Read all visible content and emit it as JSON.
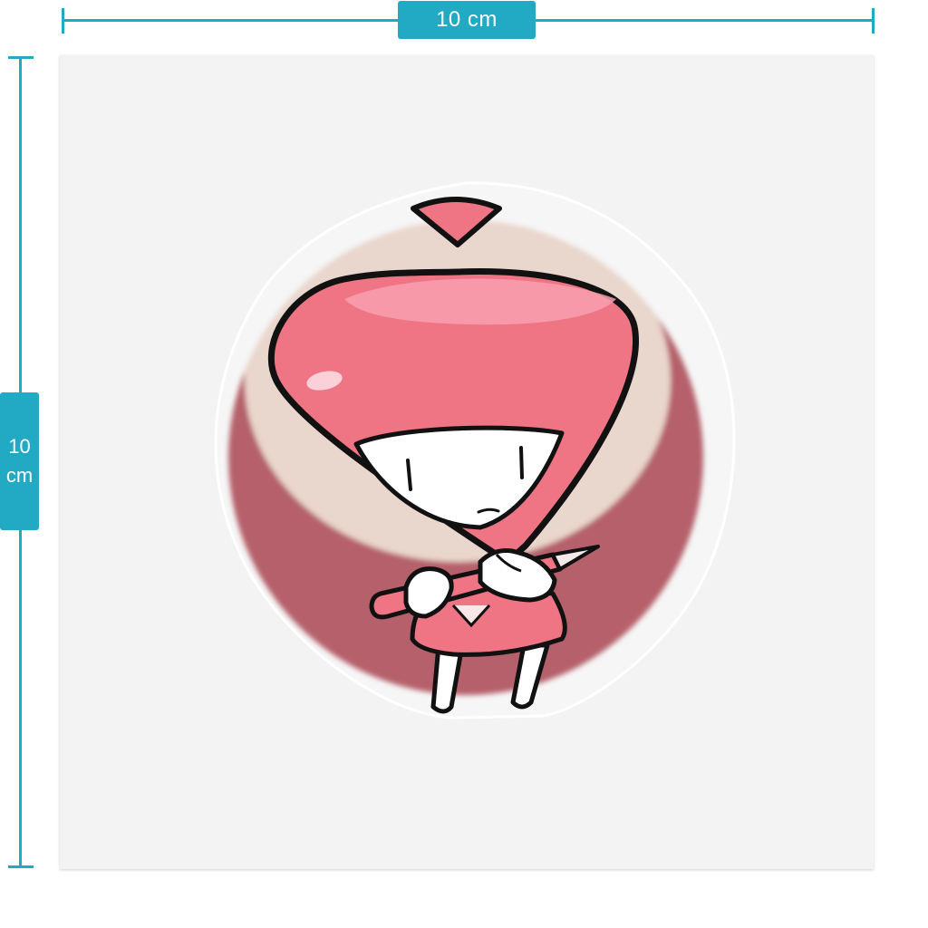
{
  "width_label": "10 cm",
  "height_label": {
    "value": "10",
    "unit": "cm"
  },
  "sticker": {
    "colors": {
      "accent": "#22a9c4",
      "sheet": "#f3f3f3",
      "bg_circle_dark": "#b5606b",
      "bg_circle_light": "#e9d6cc",
      "character_pink": "#ef7585",
      "highlight_pink": "#f9a0b0",
      "outline": "#111111",
      "white": "#ffffff"
    }
  }
}
